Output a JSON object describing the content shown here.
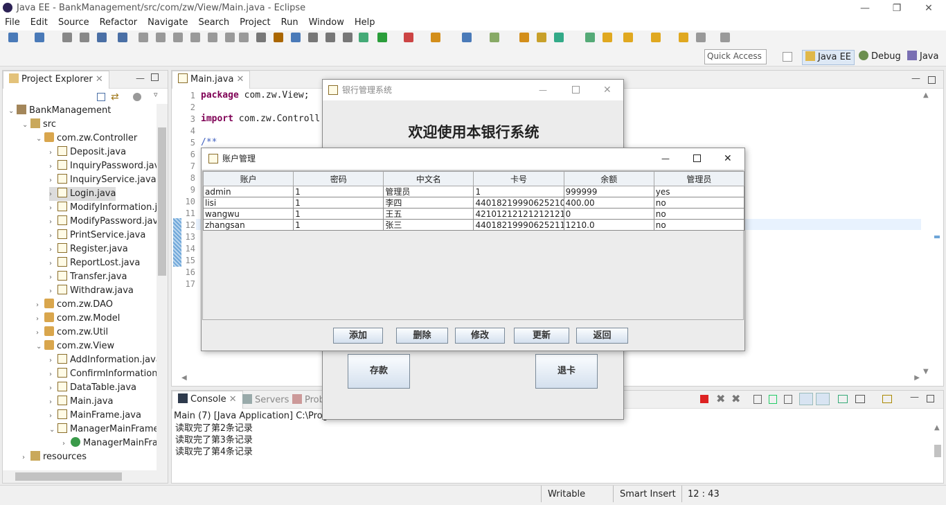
{
  "window": {
    "title": "Java EE - BankManagement/src/com/zw/View/Main.java - Eclipse"
  },
  "menu": [
    "File",
    "Edit",
    "Source",
    "Refactor",
    "Navigate",
    "Search",
    "Project",
    "Run",
    "Window",
    "Help"
  ],
  "toolbar": {
    "quick_access": "Quick Access",
    "perspectives": [
      "Java EE",
      "Debug",
      "Java"
    ]
  },
  "explorer": {
    "title": "Project Explorer",
    "items": [
      {
        "label": "BankManagement",
        "depth": 0,
        "open": true,
        "type": "project"
      },
      {
        "label": "src",
        "depth": 1,
        "open": true,
        "type": "folder"
      },
      {
        "label": "com.zw.Controller",
        "depth": 2,
        "open": true,
        "type": "package"
      },
      {
        "label": "Deposit.java",
        "depth": 3,
        "type": "java"
      },
      {
        "label": "InquiryPassword.java",
        "depth": 3,
        "type": "java"
      },
      {
        "label": "InquiryService.java",
        "depth": 3,
        "type": "java"
      },
      {
        "label": "Login.java",
        "depth": 3,
        "type": "java",
        "selected": true
      },
      {
        "label": "ModifyInformation.ja",
        "depth": 3,
        "type": "java"
      },
      {
        "label": "ModifyPassword.jav",
        "depth": 3,
        "type": "java"
      },
      {
        "label": "PrintService.java",
        "depth": 3,
        "type": "java"
      },
      {
        "label": "Register.java",
        "depth": 3,
        "type": "java"
      },
      {
        "label": "ReportLost.java",
        "depth": 3,
        "type": "java"
      },
      {
        "label": "Transfer.java",
        "depth": 3,
        "type": "java"
      },
      {
        "label": "Withdraw.java",
        "depth": 3,
        "type": "java"
      },
      {
        "label": "com.zw.DAO",
        "depth": 2,
        "type": "package"
      },
      {
        "label": "com.zw.Model",
        "depth": 2,
        "type": "package"
      },
      {
        "label": "com.zw.Util",
        "depth": 2,
        "type": "package"
      },
      {
        "label": "com.zw.View",
        "depth": 2,
        "open": true,
        "type": "package"
      },
      {
        "label": "AddInformation.java",
        "depth": 3,
        "type": "java"
      },
      {
        "label": "ConfirmInformation.",
        "depth": 3,
        "type": "java"
      },
      {
        "label": "DataTable.java",
        "depth": 3,
        "type": "java"
      },
      {
        "label": "Main.java",
        "depth": 3,
        "type": "java"
      },
      {
        "label": "MainFrame.java",
        "depth": 3,
        "type": "java"
      },
      {
        "label": "ManagerMainFrame",
        "depth": 3,
        "open": true,
        "type": "java"
      },
      {
        "label": "ManagerMainFra",
        "depth": 4,
        "type": "class"
      },
      {
        "label": "resources",
        "depth": 1,
        "type": "folder"
      }
    ]
  },
  "editor": {
    "tab": "Main.java",
    "line_numbers": [
      "1",
      "2",
      "3",
      "4",
      "5",
      "6",
      "7",
      "8",
      "9",
      "10",
      "11",
      "12",
      "13",
      "14",
      "15",
      "16",
      "17"
    ],
    "code": [
      "package com.zw.View;",
      "import com.zw.Controll",
      "/**"
    ]
  },
  "console": {
    "tabs": [
      "Console",
      "Servers",
      "Prob"
    ],
    "header": "Main (7) [Java Application] C:\\Progra",
    "lines": [
      "读取完了第2条记录",
      "读取完了第3条记录",
      "读取完了第4条记录"
    ]
  },
  "bank_window": {
    "title": "银行管理系统",
    "welcome": "欢迎使用本银行系统",
    "buttons": {
      "deposit": "存款",
      "exit_card": "退卡"
    }
  },
  "account_window": {
    "title": "账户管理",
    "columns": [
      "账户",
      "密码",
      "中文名",
      "卡号",
      "余额",
      "管理员"
    ],
    "rows": [
      [
        "admin",
        "1",
        "管理员",
        "1",
        "999999",
        "yes"
      ],
      [
        "lisi",
        "1",
        "李四",
        "440182199906252109",
        "400.00",
        "no"
      ],
      [
        "wangwu",
        "1",
        "王五",
        "421012121212121212",
        "0",
        "no"
      ],
      [
        "zhangsan",
        "1",
        "张三",
        "440182199906252110",
        "1210.0",
        "no"
      ]
    ],
    "buttons": [
      "添加",
      "删除",
      "修改",
      "更新",
      "返回"
    ]
  },
  "status": {
    "writable": "Writable",
    "insert_mode": "Smart Insert",
    "position": "12 : 43"
  }
}
